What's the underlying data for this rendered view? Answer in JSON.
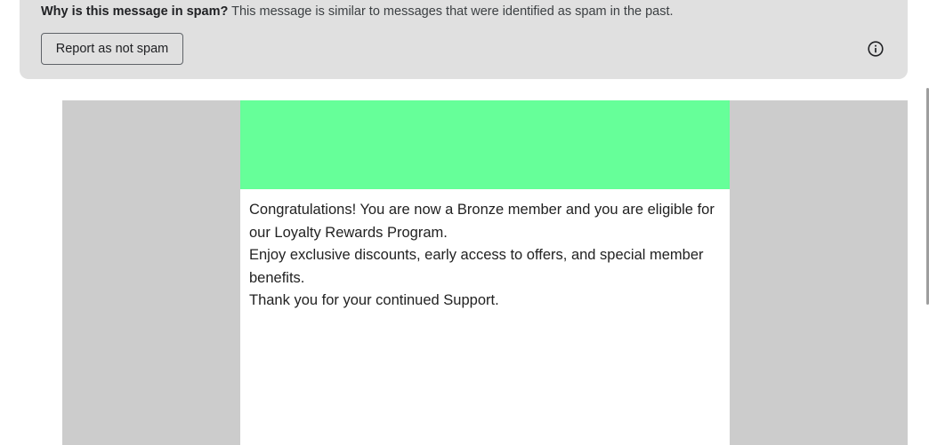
{
  "spam_banner": {
    "question": "Why is this message in spam?",
    "explanation": "This message is similar to messages that were identified as spam in the past.",
    "report_button_label": "Report as not spam",
    "info_icon": "info-icon"
  },
  "email": {
    "colors": {
      "header_band": "#66ff99",
      "backdrop": "#cccccc"
    },
    "paragraphs": [
      "Congratulations! You are now a Bronze member and you are eligible for our Loyalty Rewards Program.",
      "Enjoy exclusive discounts, early access to offers, and special member benefits.",
      "Thank you for your continued Support."
    ]
  }
}
